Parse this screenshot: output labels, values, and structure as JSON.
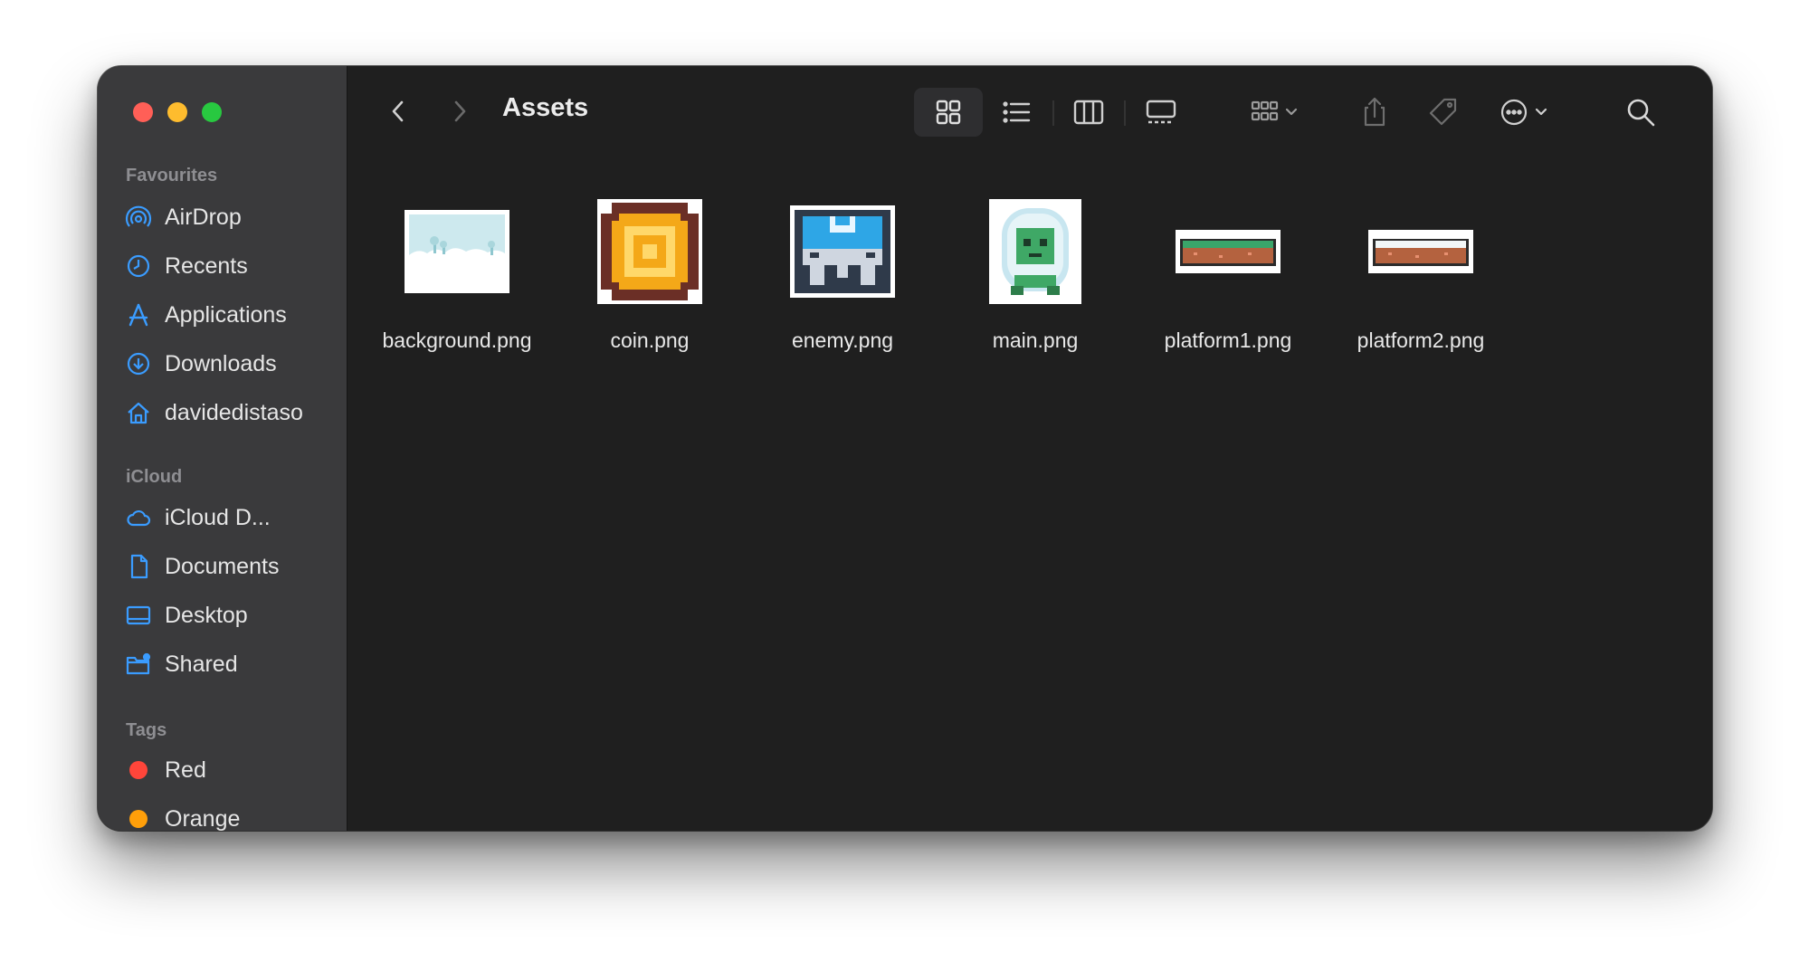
{
  "window": {
    "title": "Assets"
  },
  "sidebar": {
    "sections": {
      "favourites": "Favourites",
      "icloud": "iCloud",
      "tags": "Tags"
    },
    "favourites": [
      {
        "label": "AirDrop",
        "icon": "airdrop-icon"
      },
      {
        "label": "Recents",
        "icon": "clock-icon"
      },
      {
        "label": "Applications",
        "icon": "applications-icon"
      },
      {
        "label": "Downloads",
        "icon": "download-icon"
      },
      {
        "label": "davidedistaso",
        "icon": "home-icon"
      }
    ],
    "icloud": [
      {
        "label": "iCloud D...",
        "icon": "cloud-icon"
      },
      {
        "label": "Documents",
        "icon": "document-icon"
      },
      {
        "label": "Desktop",
        "icon": "desktop-icon"
      },
      {
        "label": "Shared",
        "icon": "shared-folder-icon"
      }
    ],
    "tags": [
      {
        "label": "Red",
        "color": "#ff453a"
      },
      {
        "label": "Orange",
        "color": "#ff9f0a"
      }
    ]
  },
  "toolbar": {
    "buttons": [
      "back-icon",
      "forward-icon",
      "icon-view-icon",
      "list-view-icon",
      "column-view-icon",
      "gallery-view-icon",
      "group-icon",
      "share-icon",
      "tag-icon",
      "more-icon",
      "search-icon"
    ]
  },
  "files": [
    {
      "name": "background.png"
    },
    {
      "name": "coin.png"
    },
    {
      "name": "enemy.png"
    },
    {
      "name": "main.png"
    },
    {
      "name": "platform1.png"
    },
    {
      "name": "platform2.png"
    }
  ],
  "colors": {
    "accent": "#3a9cff",
    "sidebar_bg": "#3a3a3c",
    "content_bg": "#1f1f1f"
  }
}
